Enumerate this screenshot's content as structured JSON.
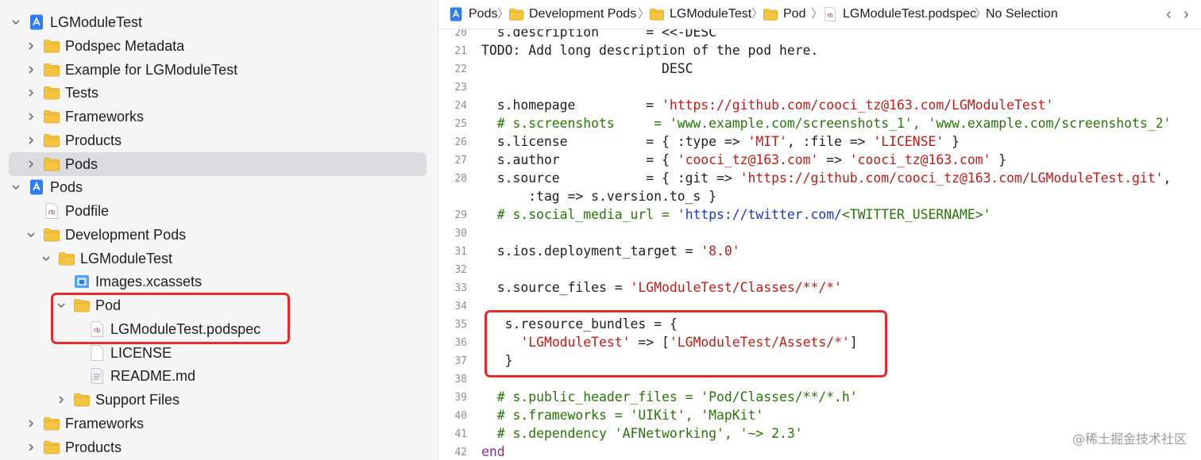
{
  "navigator": {
    "rows": [
      {
        "label": "LGModuleTest",
        "icon": "project-icon",
        "chevron": "down",
        "indent": 0
      },
      {
        "label": "Podspec Metadata",
        "icon": "folder-icon",
        "chevron": "right",
        "indent": 1
      },
      {
        "label": "Example for LGModuleTest",
        "icon": "folder-icon",
        "chevron": "right",
        "indent": 1
      },
      {
        "label": "Tests",
        "icon": "folder-icon",
        "chevron": "right",
        "indent": 1
      },
      {
        "label": "Frameworks",
        "icon": "folder-icon",
        "chevron": "right",
        "indent": 1
      },
      {
        "label": "Products",
        "icon": "folder-icon",
        "chevron": "right",
        "indent": 1
      },
      {
        "label": "Pods",
        "icon": "folder-icon",
        "chevron": "right",
        "indent": 1,
        "selected": true
      },
      {
        "label": "Pods",
        "icon": "project-icon",
        "chevron": "down",
        "indent": 0
      },
      {
        "label": "Podfile",
        "icon": "ruby-file-icon",
        "chevron": "none",
        "indent": 1
      },
      {
        "label": "Development Pods",
        "icon": "folder-icon",
        "chevron": "down",
        "indent": 1
      },
      {
        "label": "LGModuleTest",
        "icon": "folder-icon",
        "chevron": "down",
        "indent": 2
      },
      {
        "label": "Images.xcassets",
        "icon": "asset-catalog-icon",
        "chevron": "none",
        "indent": 3
      },
      {
        "label": "Pod",
        "icon": "folder-icon",
        "chevron": "down",
        "indent": 3
      },
      {
        "label": "LGModuleTest.podspec",
        "icon": "ruby-file-icon",
        "chevron": "none",
        "indent": 4
      },
      {
        "label": "LICENSE",
        "icon": "document-icon",
        "chevron": "none",
        "indent": 4
      },
      {
        "label": "README.md",
        "icon": "text-document-icon",
        "chevron": "none",
        "indent": 4
      },
      {
        "label": "Support Files",
        "icon": "folder-icon",
        "chevron": "right",
        "indent": 3
      },
      {
        "label": "Frameworks",
        "icon": "folder-icon",
        "chevron": "right",
        "indent": 1
      },
      {
        "label": "Products",
        "icon": "folder-icon",
        "chevron": "right",
        "indent": 1
      }
    ]
  },
  "jumpbar": {
    "items": [
      {
        "label": "Pods",
        "icon": "project-icon"
      },
      {
        "label": "Development Pods",
        "icon": "folder-icon"
      },
      {
        "label": "LGModuleTest",
        "icon": "folder-icon"
      },
      {
        "label": "Pod",
        "icon": "folder-icon"
      },
      {
        "label": "LGModuleTest.podspec",
        "icon": "ruby-file-icon"
      },
      {
        "label": "No Selection",
        "icon": ""
      }
    ],
    "back_icon": "chevron-left-icon",
    "forward_icon": "chevron-right-icon"
  },
  "editor": {
    "lines": [
      {
        "num": "20",
        "segs": [
          {
            "t": "  s.description      = <<-DESC",
            "c": ""
          }
        ]
      },
      {
        "num": "21",
        "segs": [
          {
            "t": "TODO: Add long description of the pod here.",
            "c": ""
          }
        ]
      },
      {
        "num": "22",
        "segs": [
          {
            "t": "                       DESC",
            "c": ""
          }
        ]
      },
      {
        "num": "23",
        "segs": []
      },
      {
        "num": "24",
        "segs": [
          {
            "t": "  s.homepage         = ",
            "c": ""
          },
          {
            "t": "'https://github.com/cooci_tz@163.com/LGModuleTest'",
            "c": "str"
          }
        ]
      },
      {
        "num": "25",
        "segs": [
          {
            "t": "  # s.screenshots     = 'www.example.com/screenshots_1', 'www.example.com/screenshots_2'",
            "c": "cmt"
          }
        ]
      },
      {
        "num": "26",
        "segs": [
          {
            "t": "  s.license          = { :type => ",
            "c": ""
          },
          {
            "t": "'MIT'",
            "c": "str"
          },
          {
            "t": ", :file => ",
            "c": ""
          },
          {
            "t": "'LICENSE'",
            "c": "str"
          },
          {
            "t": " }",
            "c": ""
          }
        ]
      },
      {
        "num": "27",
        "segs": [
          {
            "t": "  s.author           = { ",
            "c": ""
          },
          {
            "t": "'cooci_tz@163.com'",
            "c": "str"
          },
          {
            "t": " => ",
            "c": ""
          },
          {
            "t": "'cooci_tz@163.com'",
            "c": "str"
          },
          {
            "t": " }",
            "c": ""
          }
        ]
      },
      {
        "num": "28",
        "segs": [
          {
            "t": "  s.source           = { :git => ",
            "c": ""
          },
          {
            "t": "'https://github.com/cooci_tz@163.com/LGModuleTest.git'",
            "c": "str"
          },
          {
            "t": ",",
            "c": ""
          }
        ]
      },
      {
        "num": "",
        "segs": [
          {
            "t": "      :tag => s.version.to_s }",
            "c": ""
          }
        ]
      },
      {
        "num": "29",
        "segs": [
          {
            "t": "  # s.social_media_url = '",
            "c": "cmt"
          },
          {
            "t": "https://twitter.com/",
            "c": "url"
          },
          {
            "t": "<TWITTER_USERNAME>'",
            "c": "cmt"
          }
        ]
      },
      {
        "num": "30",
        "segs": []
      },
      {
        "num": "31",
        "segs": [
          {
            "t": "  s.ios.deployment_target = ",
            "c": ""
          },
          {
            "t": "'8.0'",
            "c": "str"
          }
        ]
      },
      {
        "num": "32",
        "segs": []
      },
      {
        "num": "33",
        "segs": [
          {
            "t": "  s.source_files = ",
            "c": ""
          },
          {
            "t": "'LGModuleTest/Classes/**/*'",
            "c": "str"
          }
        ]
      },
      {
        "num": "34",
        "segs": []
      },
      {
        "num": "35",
        "segs": [
          {
            "t": "   s.resource_bundles = {",
            "c": ""
          }
        ]
      },
      {
        "num": "36",
        "segs": [
          {
            "t": "     ",
            "c": ""
          },
          {
            "t": "'LGModuleTest'",
            "c": "str"
          },
          {
            "t": " => [",
            "c": ""
          },
          {
            "t": "'LGModuleTest/Assets/*'",
            "c": "str"
          },
          {
            "t": "]",
            "c": ""
          }
        ]
      },
      {
        "num": "37",
        "segs": [
          {
            "t": "   }",
            "c": ""
          }
        ]
      },
      {
        "num": "38",
        "segs": []
      },
      {
        "num": "39",
        "segs": [
          {
            "t": "  # s.public_header_files = 'Pod/Classes/**/*.h'",
            "c": "cmt"
          }
        ]
      },
      {
        "num": "40",
        "segs": [
          {
            "t": "  # s.frameworks = 'UIKit', 'MapKit'",
            "c": "cmt"
          }
        ]
      },
      {
        "num": "41",
        "segs": [
          {
            "t": "  # s.dependency 'AFNetworking', '~> 2.3'",
            "c": "cmt"
          }
        ]
      },
      {
        "num": "42",
        "segs": [
          {
            "t": "end",
            "c": "kw"
          }
        ]
      }
    ]
  },
  "watermark": "@稀土掘金技术社区",
  "colors": {
    "highlight": "#e62b2b",
    "string": "#c41a16",
    "comment": "#267507",
    "keyword": "#9b2393",
    "url": "#1a35c8",
    "folder": "#f5c542",
    "project": "#2f7bf6"
  }
}
